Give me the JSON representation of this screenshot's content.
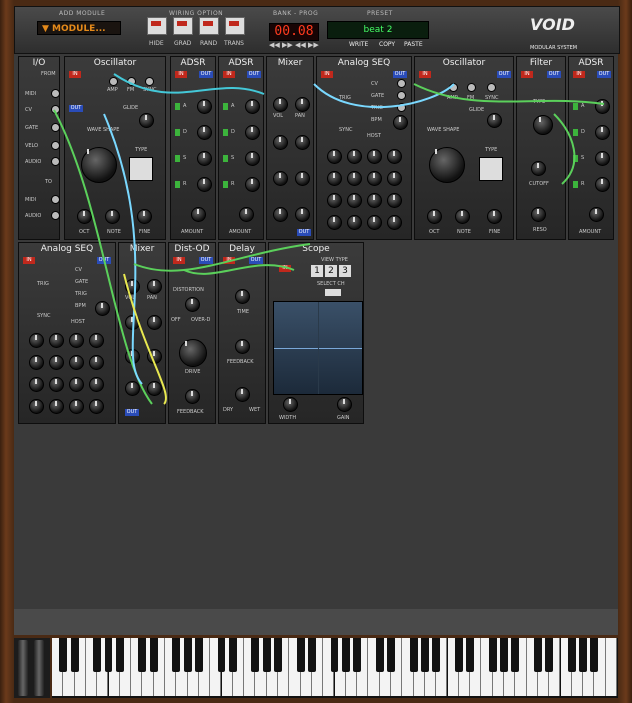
{
  "app": {
    "logo": "VOID",
    "logo_sub": "MODULAR SYSTEM"
  },
  "topbar": {
    "add_module_label": "ADD MODULE",
    "add_module_value": "▼ MODULE...",
    "wiring_label": "WIRING OPTION",
    "wiring_options": [
      "HIDE",
      "GRAD",
      "RAND",
      "TRANS"
    ],
    "bank_label": "BANK - PROG",
    "bank_value": "00.08",
    "preset_label": "PRESET",
    "preset_value": "beat 2",
    "preset_actions": [
      "WRITE",
      "COPY",
      "PASTE"
    ]
  },
  "modules": {
    "io": {
      "title": "I/O",
      "from": "FROM",
      "to": "TO",
      "labels": [
        "MIDI",
        "CV",
        "GATE",
        "VELO",
        "AUDIO"
      ],
      "to_labels": [
        "MIDI",
        "AUDIO"
      ]
    },
    "osc1": {
      "title": "Oscillator",
      "labels": [
        "AMP",
        "FM",
        "SYNC",
        "GLIDE",
        "WAVE SHAPE",
        "TYPE",
        "OCT",
        "NOTE",
        "FINE"
      ]
    },
    "adsr1": {
      "title": "ADSR",
      "letters": [
        "A",
        "D",
        "S",
        "R"
      ],
      "amount": "AMOUNT"
    },
    "adsr2": {
      "title": "ADSR",
      "letters": [
        "A",
        "D",
        "S",
        "R"
      ],
      "amount": "AMOUNT"
    },
    "mixer1": {
      "title": "Mixer",
      "vol": "VOL",
      "pan": "PAN"
    },
    "seq1": {
      "title": "Analog SEQ",
      "labels": [
        "CV",
        "GATE",
        "TRIG",
        "BPM",
        "HOST",
        "TRIG",
        "SYNC"
      ]
    },
    "osc2": {
      "title": "Oscillator",
      "labels": [
        "AMP",
        "FM",
        "SYNC",
        "GLIDE",
        "WAVE SHAPE",
        "TYPE",
        "OCT",
        "NOTE",
        "FINE"
      ]
    },
    "filter": {
      "title": "Filter",
      "labels": [
        "TYPE",
        "CUTOFF",
        "RESO"
      ]
    },
    "adsr3": {
      "title": "ADSR",
      "letters": [
        "A",
        "D",
        "S",
        "R"
      ],
      "amount": "AMOUNT"
    },
    "seq2": {
      "title": "Analog SEQ",
      "labels": [
        "CV",
        "GATE",
        "TRIG",
        "BPM",
        "HOST",
        "TRIG",
        "SYNC"
      ]
    },
    "mixer2": {
      "title": "Mixer",
      "vol": "VOL",
      "pan": "PAN"
    },
    "distod": {
      "title": "Dist-OD",
      "labels": [
        "DISTORTION",
        "OFF",
        "OVER-D",
        "DRIVE",
        "FEEDBACK"
      ]
    },
    "delay": {
      "title": "Delay",
      "labels": [
        "TIME",
        "FEEDBACK",
        "DRY",
        "WET"
      ]
    },
    "scope": {
      "title": "Scope",
      "labels": [
        "VIEW TYPE",
        "SELECT CH",
        "WIDTH",
        "GAIN"
      ],
      "view_types": [
        "1",
        "2",
        "3"
      ]
    }
  },
  "tags": {
    "in": "IN",
    "out": "OUT"
  },
  "colors": {
    "accent_orange": "#e58a1a",
    "tag_in": "#c0281c",
    "tag_out": "#2a4cb8",
    "preset_text": "#46ff66",
    "led_text": "#ff3b1f"
  }
}
